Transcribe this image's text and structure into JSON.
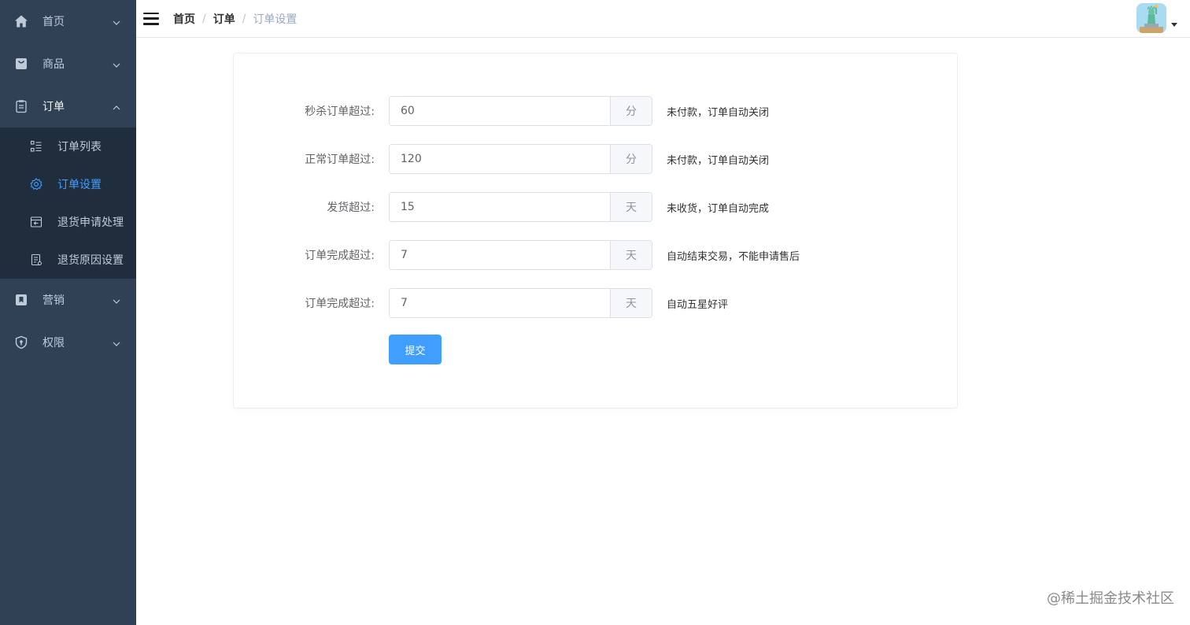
{
  "sidebar": {
    "items": [
      {
        "label": "首页",
        "icon": "home-icon"
      },
      {
        "label": "商品",
        "icon": "shopping-bag-icon"
      },
      {
        "label": "订单",
        "icon": "clipboard-icon"
      },
      {
        "label": "营销",
        "icon": "bookmark-icon"
      },
      {
        "label": "权限",
        "icon": "shield-icon"
      }
    ],
    "order_submenu": [
      {
        "label": "订单列表",
        "icon": "list-icon"
      },
      {
        "label": "订单设置",
        "icon": "gear-icon"
      },
      {
        "label": "退货申请处理",
        "icon": "return-box-icon"
      },
      {
        "label": "退货原因设置",
        "icon": "document-icon"
      }
    ],
    "active_color": "#409eff"
  },
  "header": {
    "breadcrumb": [
      "首页",
      "订单",
      "订单设置"
    ],
    "separator": "/"
  },
  "form": {
    "rows": [
      {
        "label": "秒杀订单超过:",
        "value": "60",
        "unit": "分",
        "hint": "未付款，订单自动关闭"
      },
      {
        "label": "正常订单超过:",
        "value": "120",
        "unit": "分",
        "hint": "未付款，订单自动关闭"
      },
      {
        "label": "发货超过:",
        "value": "15",
        "unit": "天",
        "hint": "未收货，订单自动完成"
      },
      {
        "label": "订单完成超过:",
        "value": "7",
        "unit": "天",
        "hint": "自动结束交易，不能申请售后"
      },
      {
        "label": "订单完成超过:",
        "value": "7",
        "unit": "天",
        "hint": "自动五星好评"
      }
    ],
    "submit_label": "提交",
    "primary_color": "#409eff"
  },
  "watermark": "@稀土掘金技术社区"
}
